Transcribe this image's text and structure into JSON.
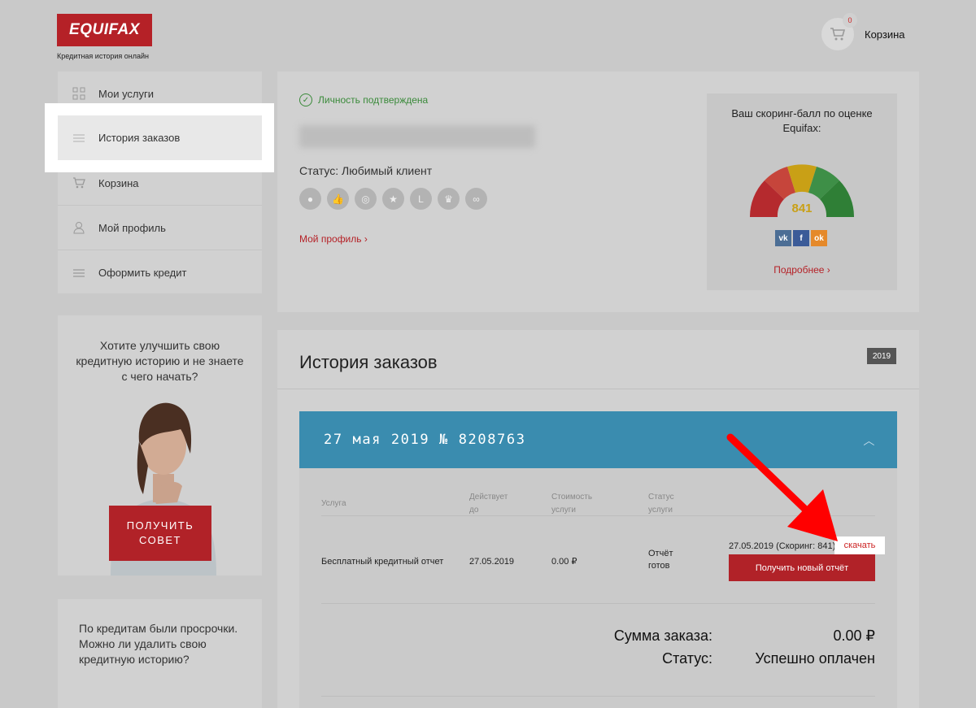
{
  "header": {
    "logo_text": "EQUIFAX",
    "logo_tagline": "Кредитная история онлайн",
    "cart_count": "0",
    "cart_label": "Корзина"
  },
  "sidebar": {
    "items": [
      {
        "label": "Мои услуги",
        "icon": "grid-icon"
      },
      {
        "label": "История заказов",
        "icon": "list-icon"
      },
      {
        "label": "Корзина",
        "icon": "cart-icon"
      },
      {
        "label": "Мой профиль",
        "icon": "user-icon"
      },
      {
        "label": "Оформить кредит",
        "icon": "list-icon"
      }
    ],
    "active_index": 1
  },
  "promo": {
    "text": "Хотите улучшить свою кредитную историю и не знаете с чего начать?",
    "button_line1": "ПОЛУЧИТЬ",
    "button_line2": "СОВЕТ"
  },
  "faq": {
    "text": "По кредитам были просрочки. Можно ли удалить свою кредитную историю?"
  },
  "profile": {
    "verified_text": "Личность подтверждена",
    "status_text": "Статус: Любимый клиент",
    "profile_link": "Мой профиль",
    "badges": [
      "user",
      "thumb",
      "target",
      "star",
      "clock",
      "crown",
      "handshake"
    ]
  },
  "score": {
    "title": "Ваш скоринг-балл по оценке Equifax:",
    "value": "841",
    "social": [
      "vk",
      "f",
      "ok"
    ],
    "more_link": "Подробнее"
  },
  "orders": {
    "title": "История заказов",
    "year": "2019",
    "order_header": "27 мая 2019 № 8208763",
    "columns": [
      "Услуга",
      "Действует до",
      "Стоимость услуги",
      "Статус услуги"
    ],
    "row": {
      "service": "Бесплатный кредитный отчет",
      "valid_until": "27.05.2019",
      "cost": "0.00 ₽",
      "status": "Отчёт готов",
      "report_info": "27.05.2019 (Скоринг: 841)",
      "download_link": "скачать",
      "new_report_button": "Получить новый отчёт"
    },
    "sum_label": "Сумма заказа:",
    "sum_value": "0.00 ₽",
    "status_label": "Статус:",
    "status_value": "Успешно оплачен"
  },
  "colors": {
    "brand_red": "#b52127",
    "order_blue": "#3a8caf",
    "verified_green": "#3a8a3a"
  }
}
